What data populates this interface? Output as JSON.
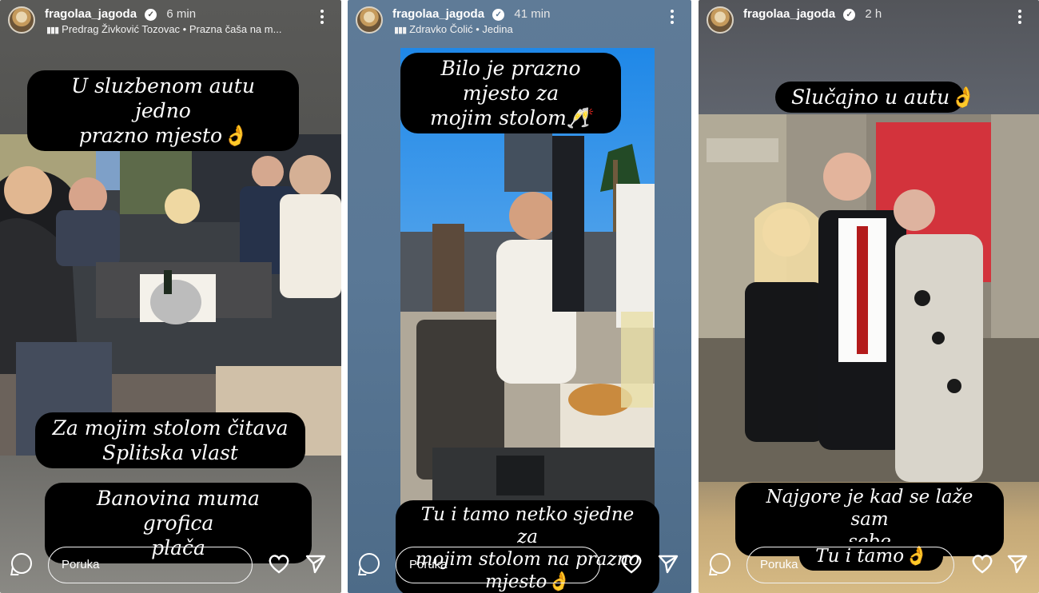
{
  "stories": [
    {
      "user": "fragolaa_jagoda",
      "time": "6 min",
      "music": "Predrag Živković Tozovac • Prazna čaša na m...",
      "captions": [
        "U sluzbenom autu jedno\nprazno mjesto👌",
        "Za mojim stolom čitava\nSplitska vlast",
        "Banovina muma grofica\nplača"
      ],
      "reply_placeholder": "Poruka"
    },
    {
      "user": "fragolaa_jagoda",
      "time": "41 min",
      "music": "Zdravko Čolić • Jedina",
      "captions": [
        "Bilo je prazno mjesto za\nmojim stolom🥂",
        "Tu i tamo netko sjedne za\nmojim stolom na prazno\nmjesto👌"
      ],
      "reply_placeholder": "Poruka"
    },
    {
      "user": "fragolaa_jagoda",
      "time": "2 h",
      "captions": [
        "Slučajno u autu👌",
        "Najgore je kad se laže sam\nsebe",
        "Tu i tamo👌"
      ],
      "reply_placeholder": "Poruka"
    }
  ],
  "icons": {
    "verified": "verified-badge-icon",
    "more": "more-vertical-icon",
    "music": "music-bars-icon",
    "reply": "comment-bubble-icon",
    "like": "heart-icon",
    "share": "send-icon"
  },
  "colors": {
    "caption_bg": "#000000",
    "caption_text": "#ffffff"
  }
}
